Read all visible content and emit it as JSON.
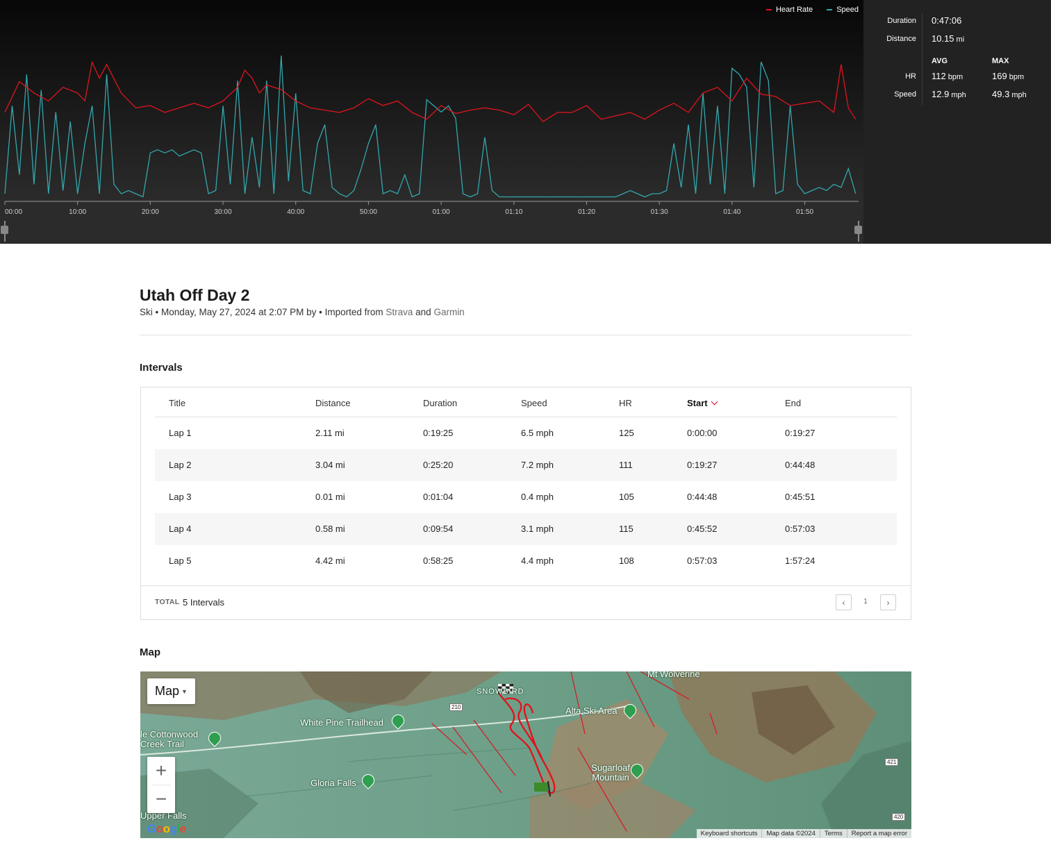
{
  "chart": {
    "legend": [
      {
        "name": "Heart Rate",
        "color": "#e0141e"
      },
      {
        "name": "Speed",
        "color": "#34a7ad"
      }
    ],
    "x_ticks": [
      "00:00",
      "10:00",
      "20:00",
      "30:00",
      "40:00",
      "50:00",
      "01:00",
      "01:10",
      "01:20",
      "01:30",
      "01:40",
      "01:50"
    ]
  },
  "chart_data": {
    "type": "line",
    "title": "",
    "x_unit": "minutes",
    "xlim": [
      0,
      117.4
    ],
    "series": [
      {
        "name": "Heart Rate",
        "color": "#e0141e",
        "x": [
          0,
          2,
          4,
          6,
          8,
          10,
          11,
          12,
          13,
          14,
          16,
          18,
          20,
          22,
          24,
          26,
          28,
          30,
          32,
          33,
          34,
          35,
          36,
          38,
          40,
          42,
          44,
          46,
          48,
          50,
          52,
          54,
          56,
          58,
          60,
          62,
          64,
          66,
          68,
          70,
          72,
          74,
          76,
          78,
          80,
          82,
          84,
          86,
          88,
          90,
          92,
          94,
          96,
          98,
          100,
          102,
          104,
          106,
          108,
          110,
          112,
          114,
          115,
          116,
          117
        ],
        "y": [
          118,
          145,
          135,
          128,
          140,
          135,
          128,
          162,
          148,
          160,
          135,
          122,
          124,
          118,
          122,
          126,
          122,
          128,
          140,
          155,
          148,
          135,
          142,
          138,
          128,
          122,
          120,
          118,
          122,
          130,
          124,
          128,
          118,
          112,
          124,
          117,
          120,
          122,
          120,
          116,
          125,
          110,
          118,
          118,
          124,
          112,
          115,
          118,
          112,
          120,
          126,
          118,
          135,
          140,
          128,
          148,
          134,
          132,
          124,
          126,
          128,
          118,
          160,
          122,
          112
        ]
      },
      {
        "name": "Speed",
        "color": "#34a7ad",
        "x": [
          0,
          1,
          2,
          3,
          4,
          5,
          6,
          7,
          8,
          9,
          10,
          11,
          12,
          13,
          14,
          15,
          16,
          17,
          18,
          19,
          20,
          21,
          22,
          23,
          24,
          25,
          26,
          27,
          28,
          29,
          30,
          31,
          32,
          33,
          34,
          35,
          36,
          37,
          38,
          39,
          40,
          41,
          42,
          43,
          44,
          45,
          46,
          47,
          48,
          49,
          50,
          51,
          52,
          53,
          54,
          55,
          56,
          57,
          58,
          59,
          60,
          61,
          62,
          63,
          64,
          65,
          66,
          67,
          68,
          69,
          70,
          71,
          72,
          73,
          74,
          75,
          76,
          77,
          78,
          79,
          80,
          81,
          82,
          83,
          84,
          85,
          86,
          87,
          88,
          89,
          90,
          91,
          92,
          93,
          94,
          95,
          96,
          97,
          98,
          99,
          100,
          101,
          102,
          103,
          104,
          105,
          106,
          107,
          108,
          109,
          110,
          111,
          112,
          113,
          114,
          115,
          116,
          117
        ],
        "y": [
          2,
          30,
          8,
          40,
          5,
          35,
          2,
          28,
          3,
          25,
          2,
          18,
          30,
          2,
          40,
          5,
          2,
          3,
          2,
          1,
          15,
          16,
          15,
          16,
          14,
          15,
          16,
          15,
          2,
          3,
          30,
          5,
          38,
          2,
          20,
          4,
          38,
          2,
          46,
          6,
          34,
          3,
          2,
          18,
          24,
          4,
          2,
          1,
          3,
          10,
          18,
          24,
          2,
          3,
          2,
          8,
          1,
          2,
          32,
          30,
          28,
          30,
          26,
          2,
          1,
          2,
          20,
          3,
          1,
          1,
          1,
          1,
          1,
          1,
          1,
          1,
          1,
          1,
          1,
          1,
          1,
          1,
          1,
          1,
          1,
          2,
          3,
          2,
          1,
          2,
          2,
          3,
          18,
          4,
          24,
          2,
          34,
          5,
          30,
          2,
          42,
          40,
          36,
          4,
          44,
          38,
          2,
          3,
          30,
          5,
          2,
          3,
          4,
          3,
          5,
          4,
          10,
          2
        ]
      }
    ]
  },
  "stats": {
    "duration_label": "Duration",
    "duration_value": "0:47:06",
    "distance_label": "Distance",
    "distance_value": "10.15",
    "distance_unit": "mi",
    "avg_head": "AVG",
    "max_head": "MAX",
    "hr_label": "HR",
    "hr_avg": "112",
    "hr_max": "169",
    "hr_unit": "bpm",
    "speed_label": "Speed",
    "speed_avg": "12.9",
    "speed_max": "49.3",
    "speed_unit": "mph"
  },
  "activity": {
    "title": "Utah Off Day 2",
    "subtitle_prefix": "Ski • Monday, May 27, 2024 at 2:07 PM by • Imported from ",
    "link1": "Strava",
    "and": " and ",
    "link2": "Garmin"
  },
  "intervals": {
    "heading": "Intervals",
    "columns": [
      "Title",
      "Distance",
      "Duration",
      "Speed",
      "HR",
      "Start",
      "End"
    ],
    "rows": [
      {
        "title": "Lap 1",
        "distance": "2.11 mi",
        "duration": "0:19:25",
        "speed": "6.5 mph",
        "hr": "125",
        "start": "0:00:00",
        "end": "0:19:27"
      },
      {
        "title": "Lap 2",
        "distance": "3.04 mi",
        "duration": "0:25:20",
        "speed": "7.2 mph",
        "hr": "111",
        "start": "0:19:27",
        "end": "0:44:48"
      },
      {
        "title": "Lap 3",
        "distance": "0.01 mi",
        "duration": "0:01:04",
        "speed": "0.4 mph",
        "hr": "105",
        "start": "0:44:48",
        "end": "0:45:51"
      },
      {
        "title": "Lap 4",
        "distance": "0.58 mi",
        "duration": "0:09:54",
        "speed": "3.1 mph",
        "hr": "115",
        "start": "0:45:52",
        "end": "0:57:03"
      },
      {
        "title": "Lap 5",
        "distance": "4.42 mi",
        "duration": "0:58:25",
        "speed": "4.4 mph",
        "hr": "108",
        "start": "0:57:03",
        "end": "1:57:24"
      }
    ],
    "total_label": "TOTAL",
    "total_value": "5 Intervals",
    "prev": "‹",
    "page": "1",
    "next": "›"
  },
  "map": {
    "heading": "Map",
    "type_label": "Map",
    "zoom_in": "+",
    "zoom_out": "−",
    "labels": {
      "white_pine": "White Pine Trailhead",
      "cottonwood": "le Cottonwood Creek Trail",
      "gloria": "Gloria Falls",
      "upper_falls": "Upper Falls",
      "alta": "Alta Ski Area",
      "sugarloaf": "Sugarloaf Mountain",
      "wolverine": "Mt Wolverine",
      "snowbird": "SNOWBIRD"
    },
    "highways": [
      "210",
      "421",
      "420"
    ],
    "google": "Google",
    "footer": [
      "Keyboard shortcuts",
      "Map data ©2024",
      "Terms",
      "Report a map error"
    ]
  }
}
